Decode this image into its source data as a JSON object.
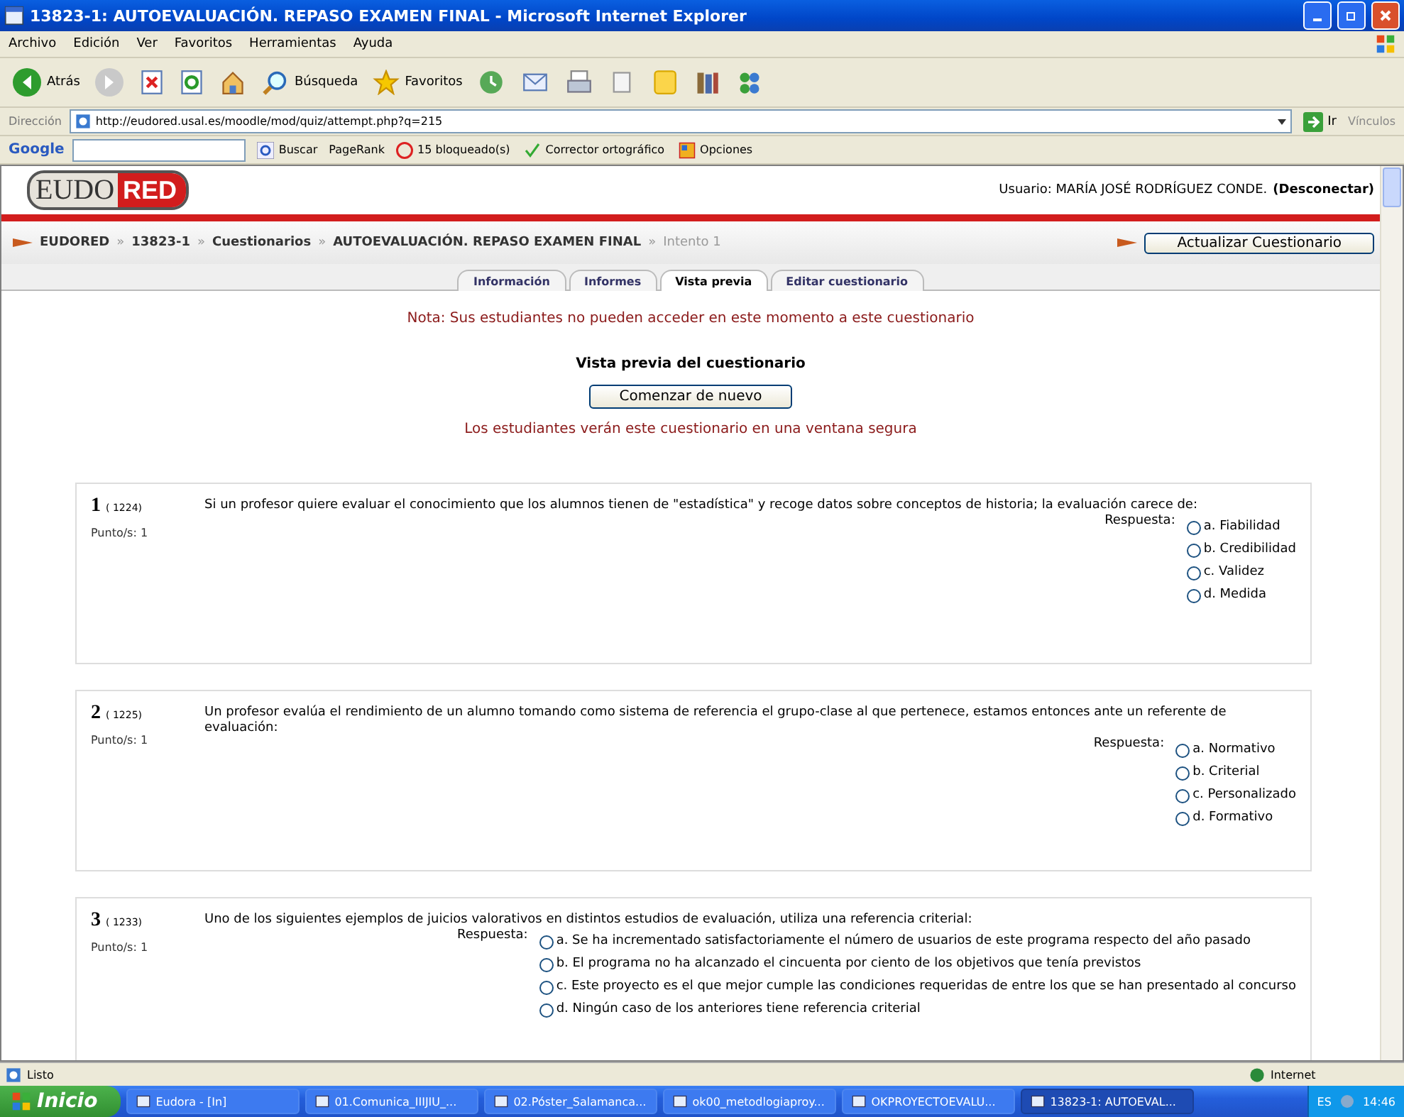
{
  "window": {
    "title": "13823-1: AUTOEVALUACIÓN. REPASO EXAMEN FINAL - Microsoft Internet Explorer"
  },
  "menu": [
    "Archivo",
    "Edición",
    "Ver",
    "Favoritos",
    "Herramientas",
    "Ayuda"
  ],
  "toolbar": [
    {
      "kind": "back",
      "label": "Atrás"
    },
    {
      "kind": "forward"
    },
    {
      "kind": "stop"
    },
    {
      "kind": "refresh"
    },
    {
      "kind": "home"
    },
    {
      "kind": "search",
      "label": "Búsqueda"
    },
    {
      "kind": "star",
      "label": "Favoritos"
    },
    {
      "kind": "history"
    },
    {
      "kind": "mail"
    },
    {
      "kind": "print"
    },
    {
      "kind": "edit"
    },
    {
      "kind": "note"
    },
    {
      "kind": "research"
    },
    {
      "kind": "messenger"
    }
  ],
  "address": {
    "label": "Dirección",
    "value": "http://eudored.usal.es/moodle/mod/quiz/attempt.php?q=215",
    "go": "Ir",
    "links": "Vínculos"
  },
  "google_bar": {
    "brand": "Google",
    "search": "Buscar",
    "pagerank": "PageRank",
    "blocked": "15 bloqueado(s)",
    "spell": "Corrector ortográfico",
    "options": "Opciones"
  },
  "site": {
    "logo_left": "EUDO",
    "logo_right": "RED",
    "user_prefix": "Usuario: MARÍA JOSÉ RODRÍGUEZ CONDE.",
    "logout": "(Desconectar)"
  },
  "breadcrumb": [
    {
      "label": "EUDORED",
      "current": false
    },
    {
      "label": "13823-1",
      "current": false
    },
    {
      "label": "Cuestionarios",
      "current": false
    },
    {
      "label": "AUTOEVALUACIÓN. REPASO EXAMEN FINAL",
      "current": false
    },
    {
      "label": "Intento 1",
      "current": true
    }
  ],
  "breadcrumb_separator": "»",
  "update_button": "Actualizar Cuestionario",
  "tabs": [
    {
      "label": "Información",
      "selected": false
    },
    {
      "label": "Informes",
      "selected": false
    },
    {
      "label": "Vista previa",
      "selected": true
    },
    {
      "label": "Editar cuestionario",
      "selected": false
    }
  ],
  "note": "Nota: Sus estudiantes no pueden acceder en este momento a este cuestionario",
  "preview_heading": "Vista previa del cuestionario",
  "restart_button": "Comenzar de nuevo",
  "secure_note": "Los estudiantes verán este cuestionario en una ventana segura",
  "questions": [
    {
      "number": "1",
      "id": "( 1224)",
      "points": "Punto/s: 1",
      "text": "Si un profesor quiere evaluar el conocimiento que los alumnos tienen de \"estadística\" y recoge datos sobre conceptos de historia; la evaluación carece de:",
      "answer_label": "Respuesta:",
      "options": [
        {
          "label": "a. Fiabilidad",
          "checked": false
        },
        {
          "label": "b. Credibilidad",
          "checked": false
        },
        {
          "label": "c. Validez",
          "checked": false
        },
        {
          "label": "d. Medida",
          "checked": false
        }
      ]
    },
    {
      "number": "2",
      "id": "( 1225)",
      "points": "Punto/s: 1",
      "text": "Un profesor evalúa el rendimiento de un alumno tomando como sistema de referencia el grupo-clase al que pertenece, estamos entonces ante un referente de evaluación:",
      "answer_label": "Respuesta:",
      "options": [
        {
          "label": "a. Normativo",
          "checked": false
        },
        {
          "label": "b. Criterial",
          "checked": false
        },
        {
          "label": "c. Personalizado",
          "checked": false
        },
        {
          "label": "d. Formativo",
          "checked": false
        }
      ]
    },
    {
      "number": "3",
      "id": "( 1233)",
      "points": "Punto/s: 1",
      "text": "Uno de los siguientes ejemplos de juicios valorativos en distintos estudios de evaluación, utiliza una referencia criterial:",
      "answer_label": "Respuesta:",
      "options": [
        {
          "label": "a. Se ha incrementado satisfactoriamente el número de usuarios de este programa respecto del año pasado",
          "checked": false
        },
        {
          "label": "b. El programa no ha alcanzado el cincuenta por ciento de los objetivos que tenía previstos",
          "checked": false
        },
        {
          "label": "c. Este proyecto es el que mejor cumple las condiciones requeridas de entre los que se han presentado al concurso",
          "checked": false
        },
        {
          "label": "d. Ningún caso de los anteriores tiene referencia criterial",
          "checked": false
        }
      ]
    }
  ],
  "status_bar": {
    "text": "Listo",
    "zone": "Internet"
  },
  "taskbar": {
    "start": "Inicio",
    "items": [
      {
        "label": "Eudora - [In]",
        "active": false
      },
      {
        "label": "01.Comunica_IIIJIU_...",
        "active": false
      },
      {
        "label": "02.Póster_Salamanca...",
        "active": false
      },
      {
        "label": "ok00_metodlogiaproy...",
        "active": false
      },
      {
        "label": "OKPROYECTOEVALU...",
        "active": false
      },
      {
        "label": "13823-1: AUTOEVAL...",
        "active": true
      }
    ],
    "lang": "ES",
    "time": "14:46"
  }
}
